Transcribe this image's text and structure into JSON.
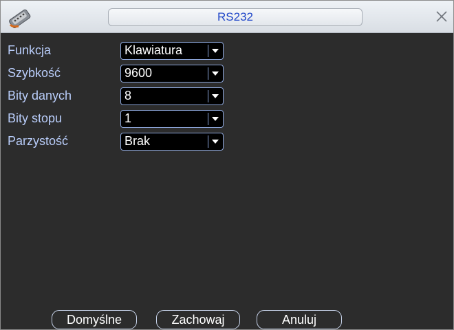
{
  "window": {
    "title": "RS232",
    "close_icon": "close-icon",
    "app_icon": "serial-port-icon"
  },
  "form": {
    "rows": [
      {
        "label": "Funkcja",
        "value": "Klawiatura"
      },
      {
        "label": "Szybkość",
        "value": "9600"
      },
      {
        "label": "Bity danych",
        "value": "8"
      },
      {
        "label": "Bity stopu",
        "value": "1"
      },
      {
        "label": "Parzystość",
        "value": "Brak"
      }
    ]
  },
  "buttons": {
    "default_label": "Domyślne",
    "save_label": "Zachowaj",
    "cancel_label": "Anuluj"
  },
  "colors": {
    "label": "#b9cdfa",
    "title": "#1f45c8",
    "background": "#2c2c2c",
    "field_border": "#8ea8dc"
  }
}
